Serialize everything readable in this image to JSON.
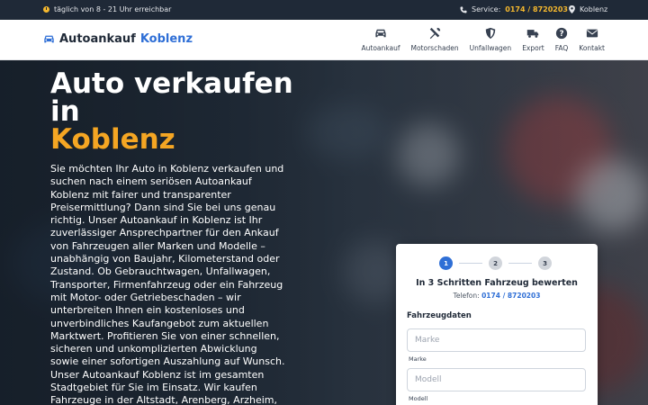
{
  "topbar": {
    "hours": "täglich von 8 - 21 Uhr erreichbar",
    "service_label": "Service:",
    "service_phone": "0174 / 8720203",
    "location": "Koblenz"
  },
  "logo": {
    "part1": "Autoankauf",
    "part2": "Koblenz"
  },
  "nav": [
    {
      "label": "Autoankauf",
      "icon": "car-icon"
    },
    {
      "label": "Motorschaden",
      "icon": "tools-icon"
    },
    {
      "label": "Unfallwagen",
      "icon": "shield-icon"
    },
    {
      "label": "Export",
      "icon": "truck-icon"
    },
    {
      "label": "FAQ",
      "icon": "question-icon"
    },
    {
      "label": "Kontakt",
      "icon": "envelope-icon"
    }
  ],
  "hero": {
    "title_line1": "Auto verkaufen",
    "title_line2": "in",
    "title_line3": "Koblenz",
    "paragraph1": "Sie möchten Ihr Auto in Koblenz verkaufen und suchen nach einem seriösen Autoankauf Koblenz mit fairer und transparenter Preisermittlung? Dann sind Sie bei uns genau richtig. Unser Autoankauf in Koblenz ist Ihr zuverlässiger Ansprechpartner für den Ankauf von Fahrzeugen aller Marken und Modelle – unabhängig von Baujahr, Kilometerstand oder Zustand. Ob Gebrauchtwagen, Unfallwagen, Transporter, Firmenfahrzeug oder ein Fahrzeug mit Motor- oder Getriebeschaden – wir unterbreiten Ihnen ein kostenloses und unverbindliches Kaufangebot zum aktuellen Marktwert. Profitieren Sie von einer schnellen, sicheren und unkomplizierten Abwicklung sowie einer sofortigen Auszahlung auf Wunsch.",
    "paragraph2": "Unser Autoankauf Koblenz ist im gesamten Stadtgebiet für Sie im Einsatz. Wir kaufen Fahrzeuge in der Altstadt, Arenberg, Arzheim, Asterstein, Bubenheim, Ehrenbreitstein,"
  },
  "form": {
    "steps": [
      "1",
      "2",
      "3"
    ],
    "active_step": 1,
    "title": "In 3 Schritten Fahrzeug bewerten",
    "phone_label": "Telefon:",
    "phone": "0174 / 8720203",
    "section": "Fahrzeugdaten",
    "make": {
      "placeholder": "Marke",
      "caption": "Marke",
      "value": ""
    },
    "model": {
      "placeholder": "Modell",
      "caption": "Modell",
      "value": ""
    }
  },
  "colors": {
    "accent_blue": "#2f6fd6",
    "accent_orange": "#f5a623",
    "topbar_bg": "#1f2937"
  }
}
